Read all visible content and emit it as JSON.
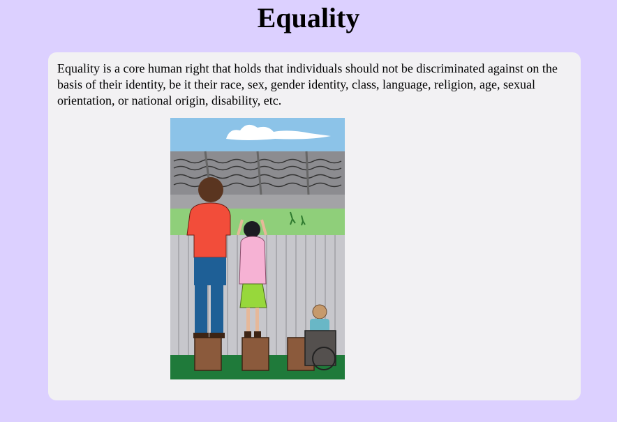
{
  "page": {
    "title": "Equality",
    "description": "Equality is a core human right that holds that individuals should not be discriminated against on the basis of their identity, be it their race, sex, gender identity, class, language, religion, age, sexual orientation, or national origin, disability, etc."
  },
  "colors": {
    "page_background": "#dcd0ff",
    "card_background": "#f2f1f3"
  },
  "illustration": {
    "subject": "three people of different heights standing on equal-sized boxes behind a fence watching a game"
  }
}
